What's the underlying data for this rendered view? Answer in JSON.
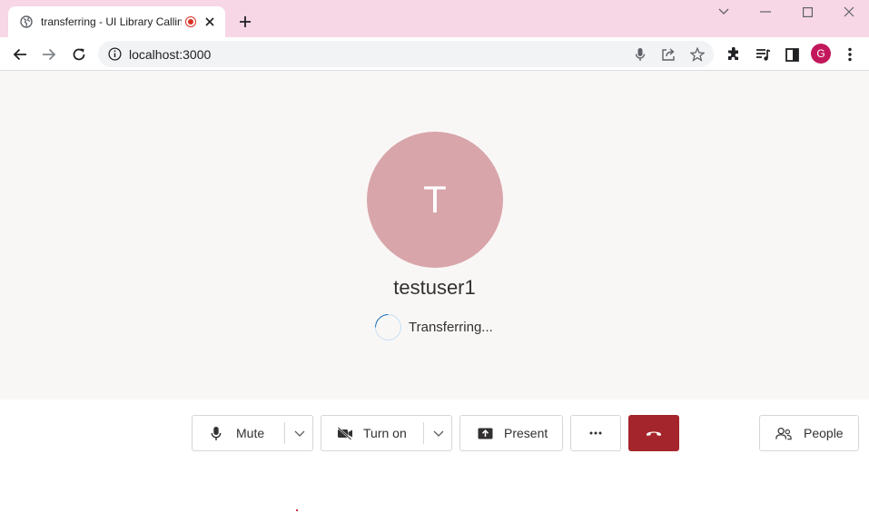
{
  "browser": {
    "tab_title": "transferring - UI Library Calling",
    "url": "localhost:3000",
    "profile_initial": "G"
  },
  "call": {
    "avatar_initial": "T",
    "display_name": "testuser1",
    "status_text": "Transferring..."
  },
  "controls": {
    "mute_label": "Mute",
    "camera_label": "Turn on",
    "present_label": "Present",
    "people_label": "People"
  },
  "colors": {
    "tab_strip": "#f7d6e6",
    "avatar_bg": "#d8a5aa",
    "end_call": "#a4262c",
    "profile": "#c2185b",
    "spinner": "#0f6cbd"
  },
  "icons": {
    "tab": [
      "globe-icon",
      "recording-icon",
      "close-icon",
      "plus-icon"
    ],
    "window": [
      "chevron-down-icon",
      "minimize-icon",
      "maximize-icon",
      "close-icon"
    ],
    "toolbar": [
      "back-icon",
      "forward-icon",
      "reload-icon",
      "info-icon",
      "microphone-icon",
      "share-icon",
      "star-icon",
      "extensions-icon",
      "media-icon",
      "sidepanel-icon",
      "menu-icon"
    ],
    "controls": [
      "microphone-icon",
      "chevron-down-icon",
      "camera-off-icon",
      "present-icon",
      "more-icon",
      "hangup-icon",
      "people-icon"
    ]
  }
}
